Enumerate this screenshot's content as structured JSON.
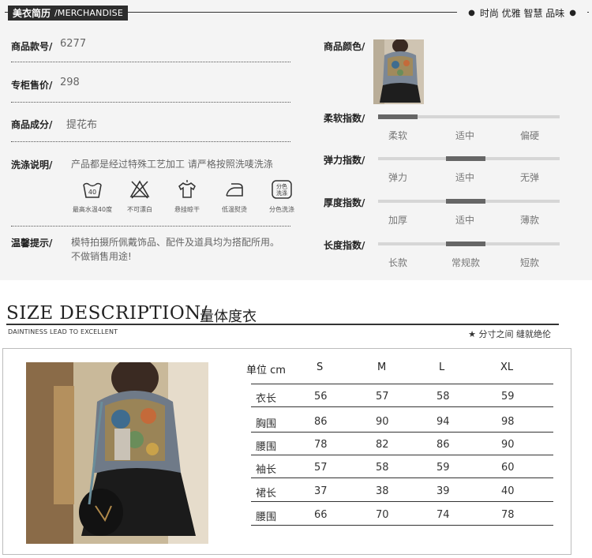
{
  "header": {
    "left_cn": "美衣简历",
    "left_en": "/MERCHANDISE",
    "right_text": "时尚 优雅 智慧 品味"
  },
  "info": {
    "style_no_label": "商品款号/",
    "style_no_value": "6277",
    "price_label": "专柜售价/",
    "price_value": "298",
    "material_label": "商品成分/",
    "material_value": "提花布",
    "wash_label": "洗涤说明/",
    "wash_value": "产品都是经过特殊工艺加工 请严格按照洗唛洗涤",
    "notice_label": "温馨提示/",
    "notice_line1": "模特拍摄所佩戴饰品、配件及道具均为搭配所用。",
    "notice_line2": "不做销售用途!"
  },
  "care_icons": [
    {
      "icon": "wash-40-icon",
      "caption": "最高水温40度"
    },
    {
      "icon": "no-bleach-icon",
      "caption": "不可漂白"
    },
    {
      "icon": "hang-dry-icon",
      "caption": "悬挂晾干"
    },
    {
      "icon": "low-iron-icon",
      "caption": "低温熨烫"
    },
    {
      "icon": "separate-wash-icon",
      "caption": "分色洗涤",
      "badge": "分色\n洗涤"
    }
  ],
  "color_label": "商品颜色/",
  "indices": [
    {
      "label": "柔软指数/",
      "low": "柔软",
      "mid": "适中",
      "high": "偏硬",
      "level": 0
    },
    {
      "label": "弹力指数/",
      "low": "弹力",
      "mid": "适中",
      "high": "无弹",
      "level": 1
    },
    {
      "label": "厚度指数/",
      "low": "加厚",
      "mid": "适中",
      "high": "薄款",
      "level": 1
    },
    {
      "label": "长度指数/",
      "low": "长款",
      "mid": "常规款",
      "high": "短款",
      "level": 1
    }
  ],
  "size_section": {
    "title_en": "SIZE DESCRIPTION/",
    "title_cn": "量体度衣",
    "subtitle": "DAINTINESS LEAD TO EXCELLENT",
    "right_note": "★ 分寸之间 缝就绝伦"
  },
  "size_table": {
    "headers": [
      "单位 cm",
      "S",
      "M",
      "L",
      "XL"
    ],
    "rows": [
      {
        "name": "衣长",
        "values": [
          "56",
          "57",
          "58",
          "59"
        ]
      },
      {
        "name": "胸围",
        "values": [
          "86",
          "90",
          "94",
          "98"
        ]
      },
      {
        "name": "腰围",
        "values": [
          "78",
          "82",
          "86",
          "90"
        ]
      },
      {
        "name": "袖长",
        "values": [
          "57",
          "58",
          "59",
          "60"
        ]
      },
      {
        "name": "裙长",
        "values": [
          "37",
          "38",
          "39",
          "40"
        ]
      },
      {
        "name": "腰围",
        "values": [
          "66",
          "70",
          "74",
          "78"
        ]
      }
    ]
  }
}
